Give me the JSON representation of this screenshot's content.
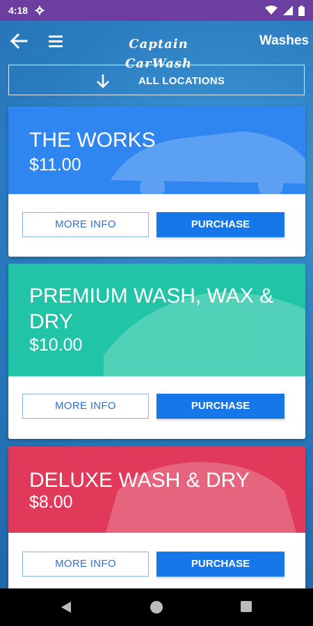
{
  "status": {
    "time": "4:18"
  },
  "header": {
    "logo_text": "Captain CarWash",
    "title": "Washes"
  },
  "locations": {
    "label": "ALL LOCATIONS"
  },
  "washes": [
    {
      "name": "THE WORKS",
      "price": "$11.00",
      "color": "#2f86f0",
      "more_info": "MORE INFO",
      "purchase": "PURCHASE"
    },
    {
      "name": "PREMIUM WASH, WAX & DRY",
      "price": "$10.00",
      "color": "#21c4a6",
      "more_info": "MORE INFO",
      "purchase": "PURCHASE"
    },
    {
      "name": "DELUXE WASH & DRY",
      "price": "$8.00",
      "color": "#e0395a",
      "more_info": "MORE INFO",
      "purchase": "PURCHASE"
    }
  ],
  "colors": {
    "status_bar": "#6b3ea0",
    "accent": "#1677e8"
  }
}
